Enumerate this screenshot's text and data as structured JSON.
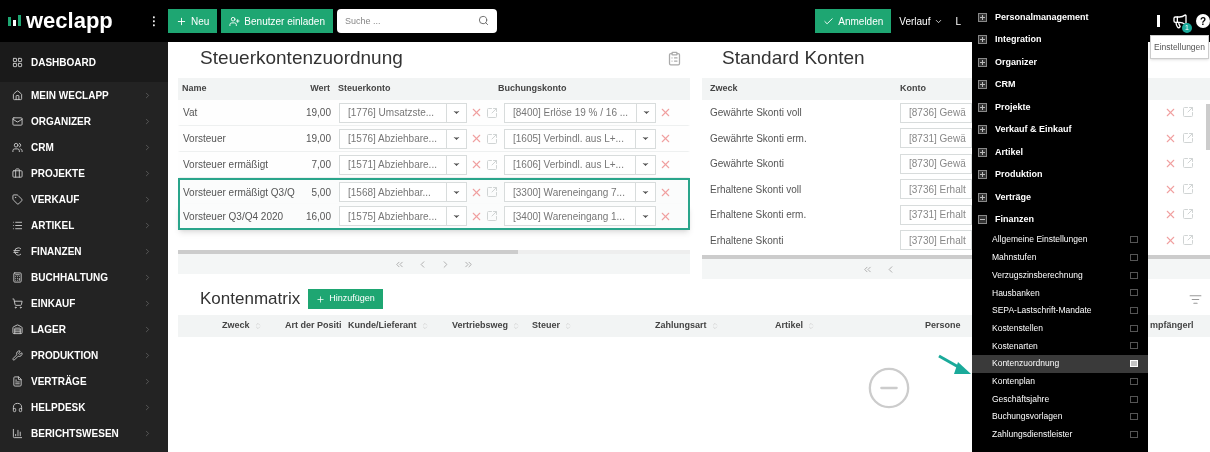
{
  "topbar": {
    "logo": "weclapp",
    "toggle": "⁝",
    "new_button": "Neu",
    "invite_button": "Benutzer einladen",
    "search": {
      "placeholder": "Suche ..."
    },
    "login_button": "Anmelden",
    "history_menu": "Verlauf",
    "cut_menu": "L",
    "notification_count": "1",
    "help": "?"
  },
  "sidebar": {
    "items": [
      {
        "label": "DASHBOARD",
        "kind": "dashboard"
      },
      {
        "label": "MEIN WECLAPP",
        "kind": "module"
      },
      {
        "label": "ORGANIZER",
        "kind": "module"
      },
      {
        "label": "CRM",
        "kind": "module"
      },
      {
        "label": "PROJEKTE",
        "kind": "module"
      },
      {
        "label": "VERKAUF",
        "kind": "module"
      },
      {
        "label": "ARTIKEL",
        "kind": "module"
      },
      {
        "label": "FINANZEN",
        "kind": "module"
      },
      {
        "label": "BUCHHALTUNG",
        "kind": "module"
      },
      {
        "label": "EINKAUF",
        "kind": "module"
      },
      {
        "label": "LAGER",
        "kind": "module"
      },
      {
        "label": "PRODUKTION",
        "kind": "module"
      },
      {
        "label": "VERTRÄGE",
        "kind": "module"
      },
      {
        "label": "HELPDESK",
        "kind": "module"
      },
      {
        "label": "BERICHTSWESEN",
        "kind": "module"
      }
    ]
  },
  "tax_panel": {
    "title": "Steuerkontenzuordnung",
    "columns": [
      "Name",
      "Wert",
      "Steuerkonto",
      "Buchungskonto"
    ],
    "rows": [
      {
        "name": "Vat",
        "value": "19,00",
        "tax_account": "[1776] Umsatzste...",
        "booking_account": "[8400] Erlöse 19 % / 16 ...",
        "highlighted": false
      },
      {
        "name": "Vorsteuer",
        "value": "19,00",
        "tax_account": "[1576] Abziehbare...",
        "booking_account": "[1605] Verbindl. aus L+...",
        "highlighted": false
      },
      {
        "name": "Vorsteuer ermäßigt",
        "value": "7,00",
        "tax_account": "[1571] Abziehbare...",
        "booking_account": "[1606] Verbindl. aus L+...",
        "highlighted": false
      },
      {
        "name": "Vorsteuer ermäßigt Q3/Q",
        "value": "5,00",
        "tax_account": "[1568] Abziehbar...",
        "booking_account": "[3300] Wareneingang 7...",
        "highlighted": true
      },
      {
        "name": "Vorsteuer Q3/Q4 2020",
        "value": "16,00",
        "tax_account": "[1575] Abziehbare...",
        "booking_account": "[3400] Wareneingang 1...",
        "highlighted": true
      }
    ]
  },
  "standard_panel": {
    "title": "Standard Konten",
    "columns": [
      "Zweck",
      "Konto"
    ],
    "rows": [
      {
        "purpose": "Gewährte Skonti voll",
        "account": "[8736] Gewä"
      },
      {
        "purpose": "Gewährte Skonti erm.",
        "account": "[8731] Gewä"
      },
      {
        "purpose": "Gewährte Skonti",
        "account": "[8730] Gewä"
      },
      {
        "purpose": "Erhaltene Skonti voll",
        "account": "[3736] Erhalt"
      },
      {
        "purpose": "Erhaltene Skonti erm.",
        "account": "[3731] Erhalt"
      },
      {
        "purpose": "Erhaltene Skonti",
        "account": "[3730] Erhalt"
      }
    ]
  },
  "matrix": {
    "title": "Kontenmatrix",
    "add_button": "Hinzufügen",
    "columns": [
      "Zweck",
      "Art der Positi",
      "Kunde/Lieferant",
      "Vertriebsweg",
      "Steuer",
      "Zahlungsart",
      "Artikel",
      "Persone",
      "mpfängerl"
    ]
  },
  "settings_menu": {
    "items": [
      {
        "label": "Personalmanagement",
        "expanded": false
      },
      {
        "label": "Integration",
        "expanded": false
      },
      {
        "label": "Organizer",
        "expanded": false
      },
      {
        "label": "CRM",
        "expanded": false
      },
      {
        "label": "Projekte",
        "expanded": false
      },
      {
        "label": "Verkauf & Einkauf",
        "expanded": false
      },
      {
        "label": "Artikel",
        "expanded": false
      },
      {
        "label": "Produktion",
        "expanded": false
      },
      {
        "label": "Verträge",
        "expanded": false
      },
      {
        "label": "Finanzen",
        "expanded": true,
        "children": [
          {
            "label": "Allgemeine Einstellungen",
            "selected": false
          },
          {
            "label": "Mahnstufen",
            "selected": false
          },
          {
            "label": "Verzugszinsberechnung",
            "selected": false
          },
          {
            "label": "Hausbanken",
            "selected": false
          },
          {
            "label": "SEPA-Lastschrift-Mandate",
            "selected": false
          },
          {
            "label": "Kostenstellen",
            "selected": false
          },
          {
            "label": "Kostenarten",
            "selected": false
          },
          {
            "label": "Kontenzuordnung",
            "selected": true
          },
          {
            "label": "Kontenplan",
            "selected": false
          },
          {
            "label": "Geschäftsjahre",
            "selected": false
          },
          {
            "label": "Buchungsvorlagen",
            "selected": false
          },
          {
            "label": "Zahlungsdienstleister",
            "selected": false
          }
        ]
      }
    ]
  },
  "tooltip": "Einstellungen"
}
